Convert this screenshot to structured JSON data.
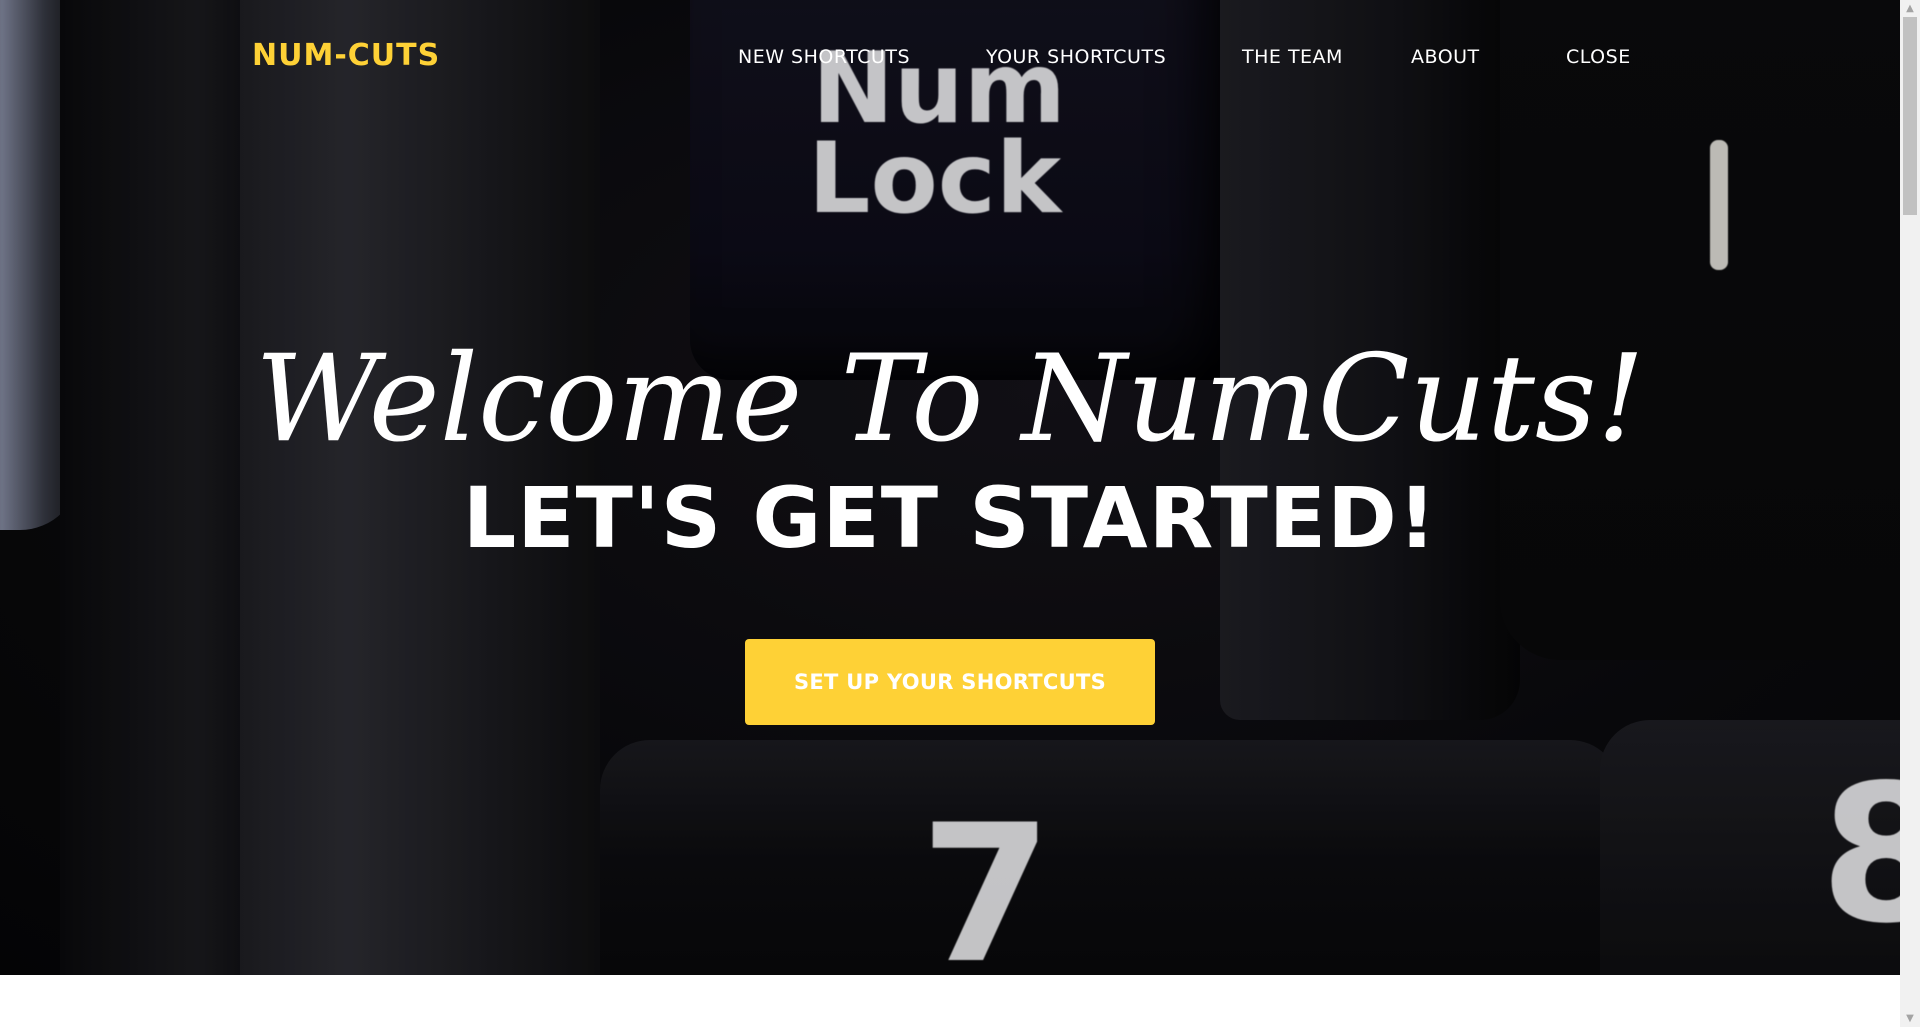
{
  "navbar": {
    "brand": "NUM-CUTS",
    "links": [
      {
        "label": "NEW SHORTCUTS"
      },
      {
        "label": "YOUR SHORTCUTS"
      },
      {
        "label": "THE TEAM"
      },
      {
        "label": "ABOUT"
      },
      {
        "label": "CLOSE"
      }
    ]
  },
  "hero": {
    "lead": "Welcome To NumCuts!",
    "heading": "LET'S GET STARTED!",
    "cta_label": "SET UP YOUR SHORTCUTS",
    "background_keys": {
      "numlock_line1": "Num",
      "numlock_line2": "Lock",
      "seven": "7",
      "eight": "8"
    }
  },
  "scrollbar": {
    "up_icon": "▲",
    "down_icon": "▼"
  },
  "colors": {
    "accent": "#fed136",
    "text_light": "#ffffff",
    "page_bg": "#ffffff"
  }
}
